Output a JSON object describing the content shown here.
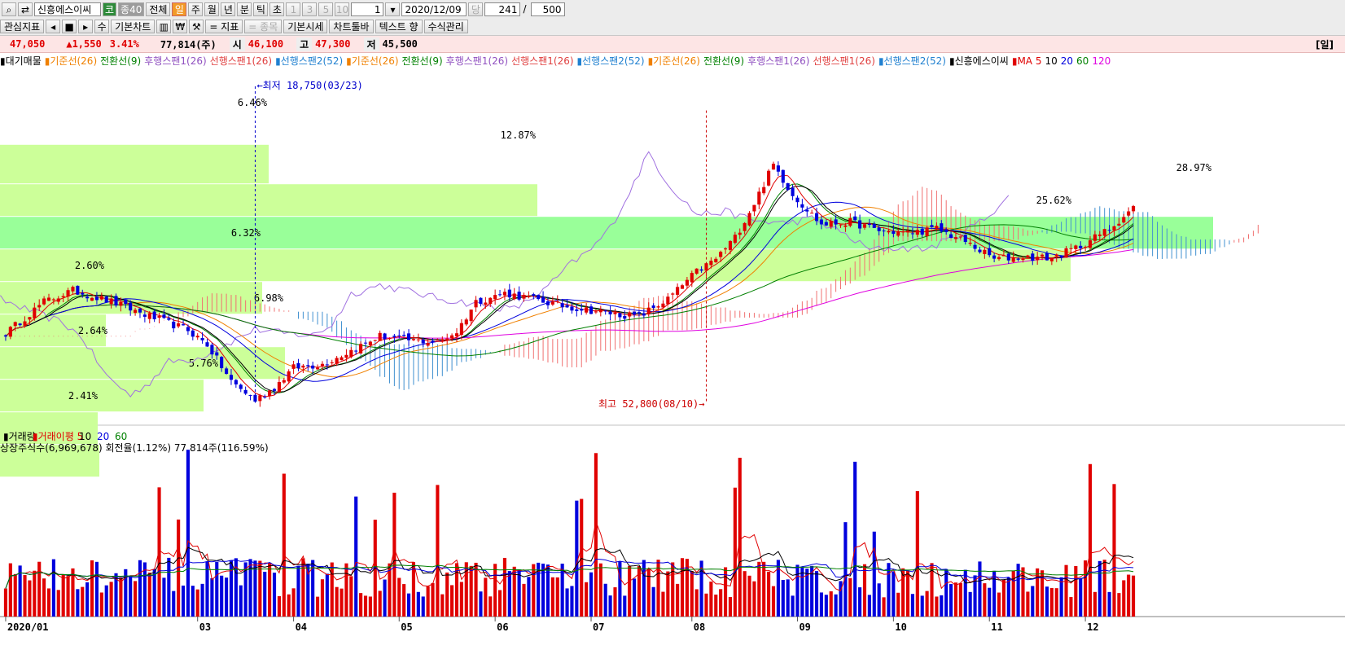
{
  "toolbar": {
    "search_icon": "magnifier-icon",
    "refresh_icon": "refresh-icon",
    "stock_name": "신흥에스이씨",
    "badge1": "코",
    "badge2": "종40",
    "all": "전체",
    "periods": [
      "일",
      "주",
      "월",
      "년",
      "분",
      "틱",
      "초"
    ],
    "nums": [
      "1",
      "3",
      "5",
      "10"
    ],
    "count": "1",
    "date": "2020/12/09",
    "dang": "당",
    "n1": "241",
    "slash": "/",
    "n2": "500",
    "watch": "관심지표",
    "nav": [
      "◂",
      "■",
      "▸",
      "수"
    ],
    "basic_chart": "기본차트",
    "won": "₩",
    "tool": "🔧",
    "indicator": "= 지표",
    "item": "= 종목",
    "basic_quote": "기본시세",
    "chart_toolbar": "차트툴바",
    "text_hyang": "텍스트 향",
    "formula": "수식관리"
  },
  "price_bar": {
    "price": "47,050",
    "change": "▲1,550",
    "pct": "3.41%",
    "volume": "77,814(주)",
    "open_label": "시",
    "open": "46,100",
    "high_label": "고",
    "high": "47,300",
    "low_label": "저",
    "low": "45,500",
    "day_btn": "[일]"
  },
  "legend_items": [
    {
      "text": "▮대기매물",
      "color": "#000000"
    },
    {
      "text": "▮기준선(26)",
      "color": "#f08000"
    },
    {
      "text": "전환선(9)",
      "color": "#008000"
    },
    {
      "text": "후행스팬1(26)",
      "color": "#9050c0"
    },
    {
      "text": "선행스팬1(26)",
      "color": "#e04040"
    },
    {
      "text": "▮선행스팬2(52)",
      "color": "#2080d0"
    },
    {
      "text": "▮기준선(26)",
      "color": "#f08000"
    },
    {
      "text": "전환선(9)",
      "color": "#008000"
    },
    {
      "text": "후행스팬1(26)",
      "color": "#9050c0"
    },
    {
      "text": "선행스팬1(26)",
      "color": "#e04040"
    },
    {
      "text": "▮선행스팬2(52)",
      "color": "#2080d0"
    },
    {
      "text": "▮기준선(26)",
      "color": "#f08000"
    },
    {
      "text": "전환선(9)",
      "color": "#008000"
    },
    {
      "text": "후행스팬1(26)",
      "color": "#9050c0"
    },
    {
      "text": "선행스팬1(26)",
      "color": "#e04040"
    },
    {
      "text": "▮선행스팬2(52)",
      "color": "#2080d0"
    },
    {
      "text": "▮신흥에스이씨",
      "color": "#000000"
    },
    {
      "text": "▮MA 5",
      "color": "#e00000"
    },
    {
      "text": "10",
      "color": "#000000"
    },
    {
      "text": "20",
      "color": "#0000dd"
    },
    {
      "text": "60",
      "color": "#008000"
    },
    {
      "text": "120",
      "color": "#e000e0"
    }
  ],
  "chart_data": {
    "type": "candlestick",
    "y_range": [
      18000,
      56000
    ],
    "x_ticks": [
      "2020/01",
      "03",
      "04",
      "05",
      "06",
      "07",
      "08",
      "09",
      "10",
      "11",
      "12"
    ],
    "annotations": [
      {
        "text": "←최저 18,750(03/23)",
        "color": "#0000cc"
      },
      {
        "text": "최고 52,800(08/10)→",
        "color": "#cc0000"
      }
    ],
    "vp_labels": [
      "6.46%",
      "12.87%",
      "28.97%",
      "6.32%",
      "2.60%",
      "6.98%",
      "2.64%",
      "5.76%",
      "2.41%",
      "25.62%"
    ],
    "vp_colors": {
      "normal": "#ccff99",
      "max": "#99ff99"
    },
    "volume_panel": {
      "legend": [
        {
          "text": "▮거래량",
          "color": "#000000"
        },
        {
          "text": "▮거래이평 5",
          "color": "#e00000"
        },
        {
          "text": "10",
          "color": "#000000"
        },
        {
          "text": "20",
          "color": "#0000dd"
        },
        {
          "text": "60",
          "color": "#008000"
        }
      ],
      "info": "상장주식수(6,969,678) 회전율(1.12%) 77,814주(116.59%)"
    },
    "colors": {
      "up": "#e00000",
      "down": "#0000dd",
      "ma5": "#e00000",
      "ma10": "#000000",
      "ma20": "#0000dd",
      "ma60": "#008000",
      "ma120": "#e000e0",
      "kijun": "#f08000",
      "tenkan": "#008000",
      "chikou": "#a070e0",
      "span1": "#e04040",
      "span2": "#2080d0"
    }
  }
}
